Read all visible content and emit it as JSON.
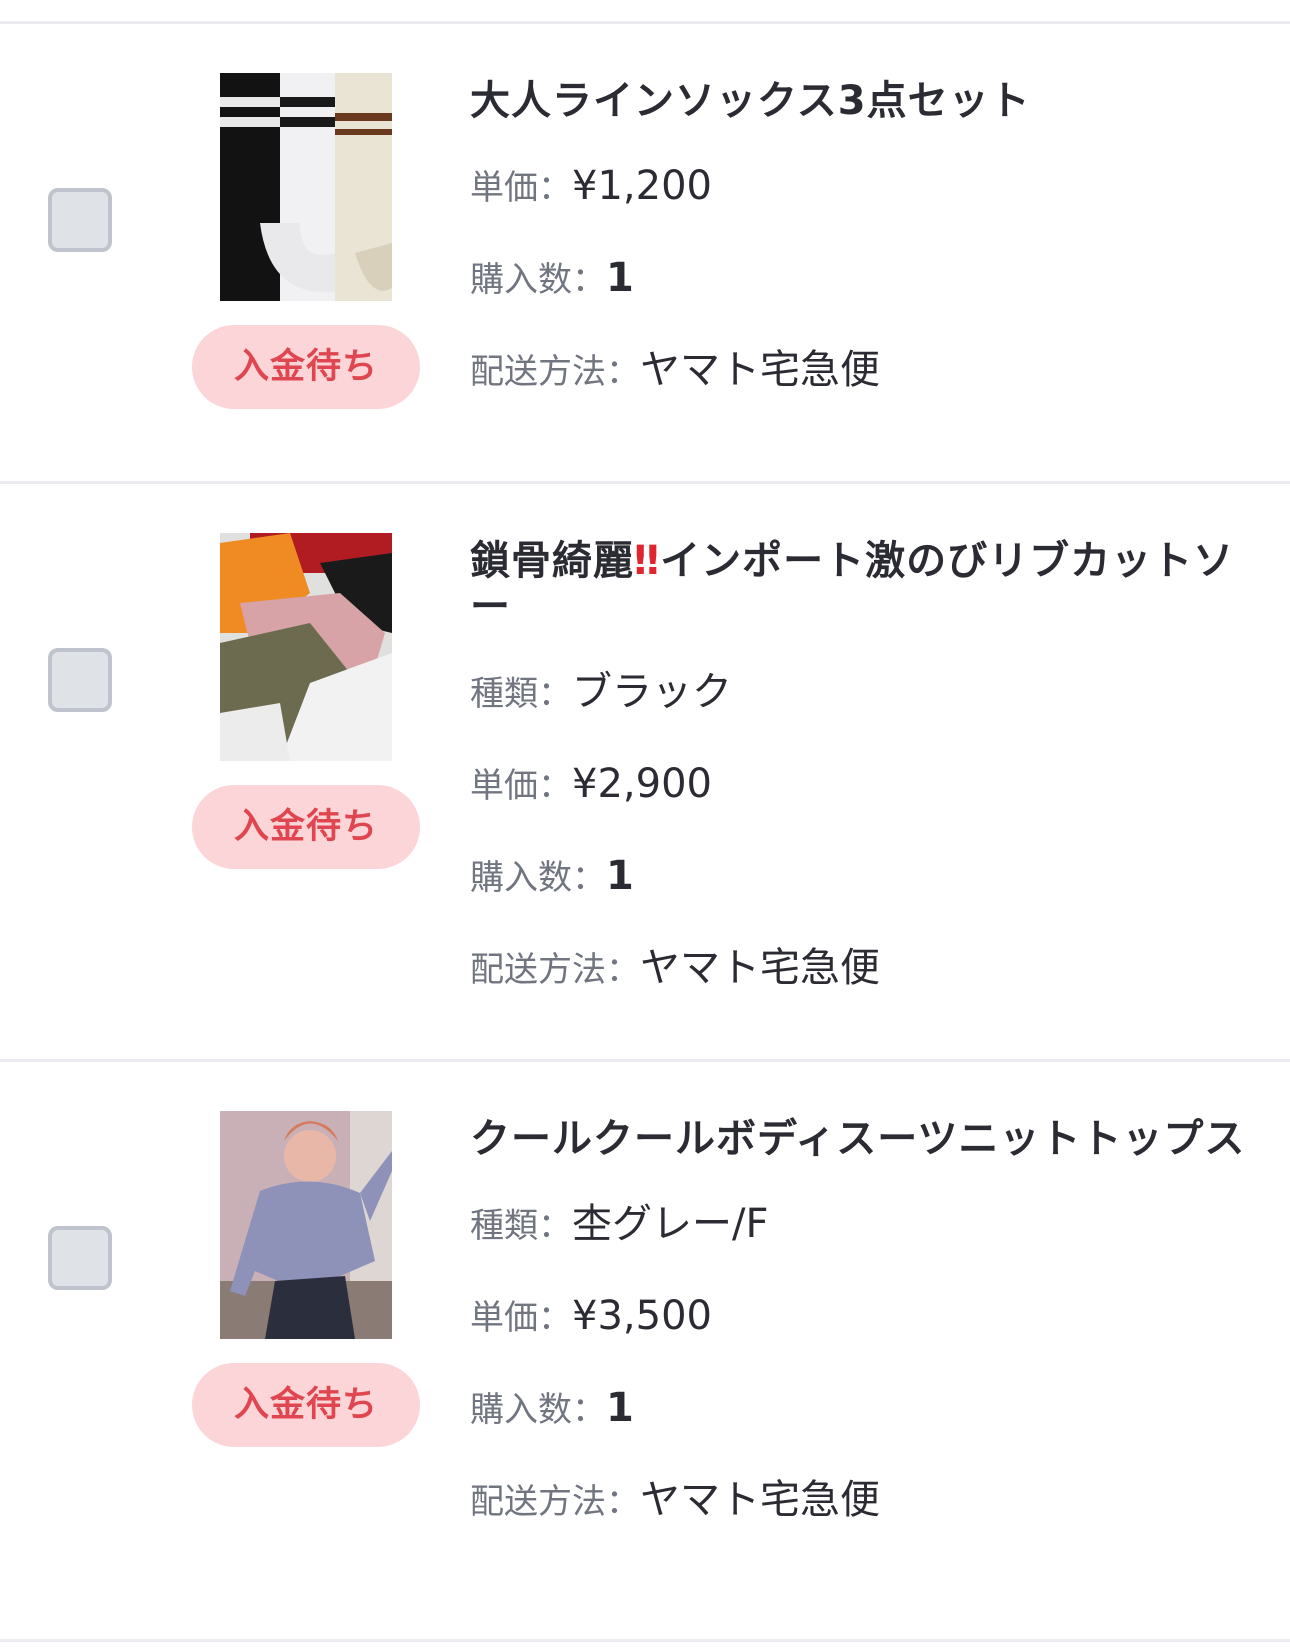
{
  "orders": [
    {
      "title": "大人ラインソックス3点セット",
      "status": "入金待ち",
      "details": [
        {
          "label": "単価：",
          "value": "¥1,200"
        },
        {
          "label": "購入数：",
          "value": "1"
        },
        {
          "label": "配送方法：",
          "value": "ヤマト宅急便"
        }
      ]
    },
    {
      "title_part1": "鎖骨綺麗",
      "title_emoji": "‼",
      "title_part2": "インポート激のびリブカットソー",
      "status": "入金待ち",
      "details": [
        {
          "label": "種類：",
          "value": "ブラック"
        },
        {
          "label": "単価：",
          "value": "¥2,900"
        },
        {
          "label": "購入数：",
          "value": "1"
        },
        {
          "label": "配送方法：",
          "value": "ヤマト宅急便"
        }
      ]
    },
    {
      "title": "クールクールボディスーツニットトップス",
      "status": "入金待ち",
      "details": [
        {
          "label": "種類：",
          "value": "杢グレー/F"
        },
        {
          "label": "単価：",
          "value": "¥3,500"
        },
        {
          "label": "購入数：",
          "value": "1"
        },
        {
          "label": "配送方法：",
          "value": "ヤマト宅急便"
        }
      ]
    }
  ],
  "colors": {
    "badge_bg": "#fcd5d8",
    "badge_text": "#e0464f",
    "label_text": "#707580",
    "value_text": "#2b2b33",
    "divider": "#ececf0",
    "checkbox_fill": "#dfe2e7"
  }
}
